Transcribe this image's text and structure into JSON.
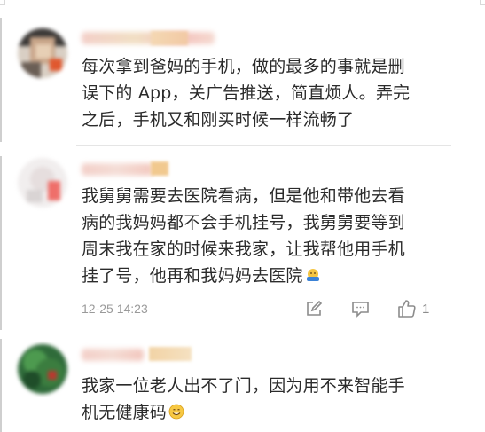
{
  "comments": [
    {
      "lines": [
        "每次拿到爸妈的手机，做的最多的事就是删",
        "误下的 App，关广告推送，简直烦人。弄完",
        "之后，手机又和刚买时候一样流畅了"
      ]
    },
    {
      "lines": [
        "我舅舅需要去医院看病，但是他和带他去看",
        "病的我妈妈都不会手机挂号，我舅舅要等到",
        "周末我在家的时候来我家，让我帮他用手机",
        "挂了号，他再和我妈妈去医院"
      ],
      "emoji_icon": "bowing-emoji-icon",
      "timestamp": "12-25 14:23",
      "like_count": "1"
    },
    {
      "lines": [
        "我家一位老人出不了门，因为用不来智能手",
        "机无健康码"
      ],
      "emoji_icon": "smiling-face-emoji-icon"
    }
  ],
  "actions": {
    "share_icon": "share-edit-icon",
    "reply_icon": "reply-comment-icon",
    "like_icon": "thumbs-up-icon"
  },
  "colors": {
    "text": "#2b2b2b",
    "meta": "#9a9a9a",
    "icon": "#8c8c8c",
    "separator": "#e5e5e5"
  }
}
